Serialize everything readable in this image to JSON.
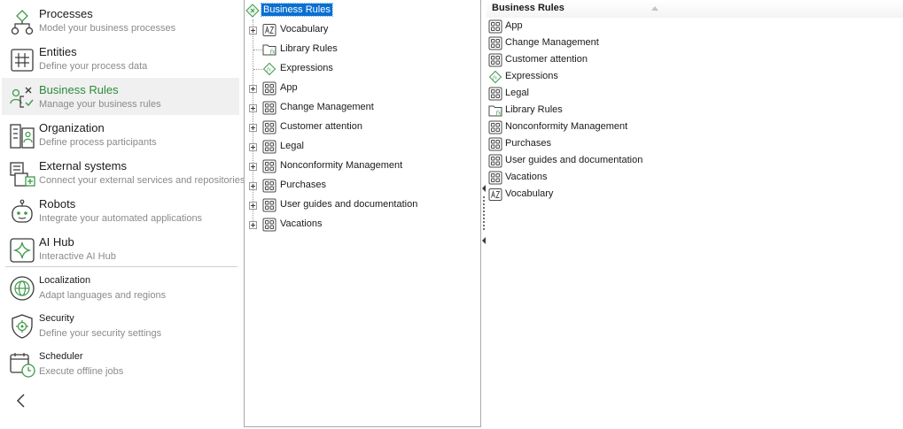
{
  "nav": {
    "items": [
      {
        "title": "Processes",
        "subtitle": "Model your business processes",
        "icon": "process-flow-icon"
      },
      {
        "title": "Entities",
        "subtitle": "Define your process data",
        "icon": "entity-grid-icon"
      },
      {
        "title": "Business Rules",
        "subtitle": "Manage your business rules",
        "icon": "business-rules-icon",
        "active": true
      },
      {
        "title": "Organization",
        "subtitle": "Define process participants",
        "icon": "organization-icon"
      },
      {
        "title": "External systems",
        "subtitle": "Connect your external services and repositories",
        "icon": "external-systems-icon"
      },
      {
        "title": "Robots",
        "subtitle": "Integrate your automated applications",
        "icon": "robot-icon"
      },
      {
        "title": "AI Hub",
        "subtitle": "Interactive AI Hub",
        "icon": "ai-sparkle-icon"
      },
      {
        "title": "Localization",
        "subtitle": "Adapt languages and regions",
        "icon": "globe-icon"
      },
      {
        "title": "Security",
        "subtitle": "Define your security settings",
        "icon": "security-gear-icon"
      },
      {
        "title": "Scheduler",
        "subtitle": "Execute offline jobs",
        "icon": "scheduler-clock-icon"
      }
    ],
    "collapse_icon": "chevron-left-icon"
  },
  "tree": {
    "root": "Business Rules",
    "children": [
      {
        "label": "Vocabulary",
        "icon": "vocabulary-icon",
        "expandable": true
      },
      {
        "label": "Library Rules",
        "icon": "library-rules-icon",
        "expandable": false
      },
      {
        "label": "Expressions",
        "icon": "expression-icon",
        "expandable": false
      },
      {
        "label": "App",
        "icon": "rule-set-icon",
        "expandable": true
      },
      {
        "label": "Change Management",
        "icon": "rule-set-icon",
        "expandable": true
      },
      {
        "label": "Customer attention",
        "icon": "rule-set-icon",
        "expandable": true
      },
      {
        "label": "Legal",
        "icon": "rule-set-icon",
        "expandable": true
      },
      {
        "label": "Nonconformity Management",
        "icon": "rule-set-icon",
        "expandable": true
      },
      {
        "label": "Purchases",
        "icon": "rule-set-icon",
        "expandable": true
      },
      {
        "label": "User guides and documentation",
        "icon": "rule-set-icon",
        "expandable": true
      },
      {
        "label": "Vacations",
        "icon": "rule-set-icon",
        "expandable": true
      }
    ]
  },
  "list": {
    "header": "Business Rules",
    "sort": "ascending",
    "items": [
      {
        "label": "App",
        "icon": "rule-set-icon"
      },
      {
        "label": "Change Management",
        "icon": "rule-set-icon"
      },
      {
        "label": "Customer attention",
        "icon": "rule-set-icon"
      },
      {
        "label": "Expressions",
        "icon": "expression-icon"
      },
      {
        "label": "Legal",
        "icon": "rule-set-icon"
      },
      {
        "label": "Library Rules",
        "icon": "library-rules-icon"
      },
      {
        "label": "Nonconformity Management",
        "icon": "rule-set-icon"
      },
      {
        "label": "Purchases",
        "icon": "rule-set-icon"
      },
      {
        "label": "User guides and documentation",
        "icon": "rule-set-icon"
      },
      {
        "label": "Vacations",
        "icon": "rule-set-icon"
      },
      {
        "label": "Vocabulary",
        "icon": "vocabulary-icon"
      }
    ]
  },
  "colors": {
    "accent": "#2a8a3a",
    "selection": "#0b6fd1",
    "icon": "#3a3a3a",
    "icon_green": "#3d9a4a"
  }
}
